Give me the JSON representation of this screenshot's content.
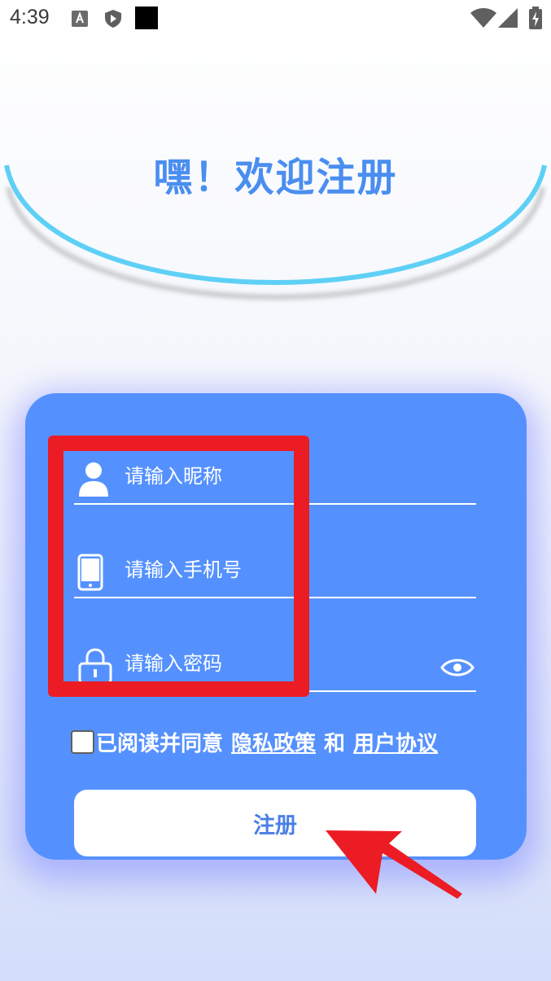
{
  "status_bar": {
    "time": "4:39",
    "icons": [
      "a-notification-icon",
      "shield-play-icon",
      "black-square-icon",
      "wifi-icon",
      "signal-icon",
      "battery-icon"
    ]
  },
  "header": {
    "title": "嘿！欢迎注册"
  },
  "form": {
    "nickname_placeholder": "请输入昵称",
    "phone_placeholder": "请输入手机号",
    "password_placeholder": "请输入密码",
    "agree_text": "已阅读并同意",
    "privacy_link": "隐私政策",
    "and_text": "和",
    "user_agreement_link": "用户协议",
    "agree_checked": false,
    "submit_label": "注册"
  },
  "colors": {
    "card": "#5591fe",
    "title": "#4a8ef0",
    "arc": "#5fd0f5",
    "annotation": "#ec1c24"
  }
}
